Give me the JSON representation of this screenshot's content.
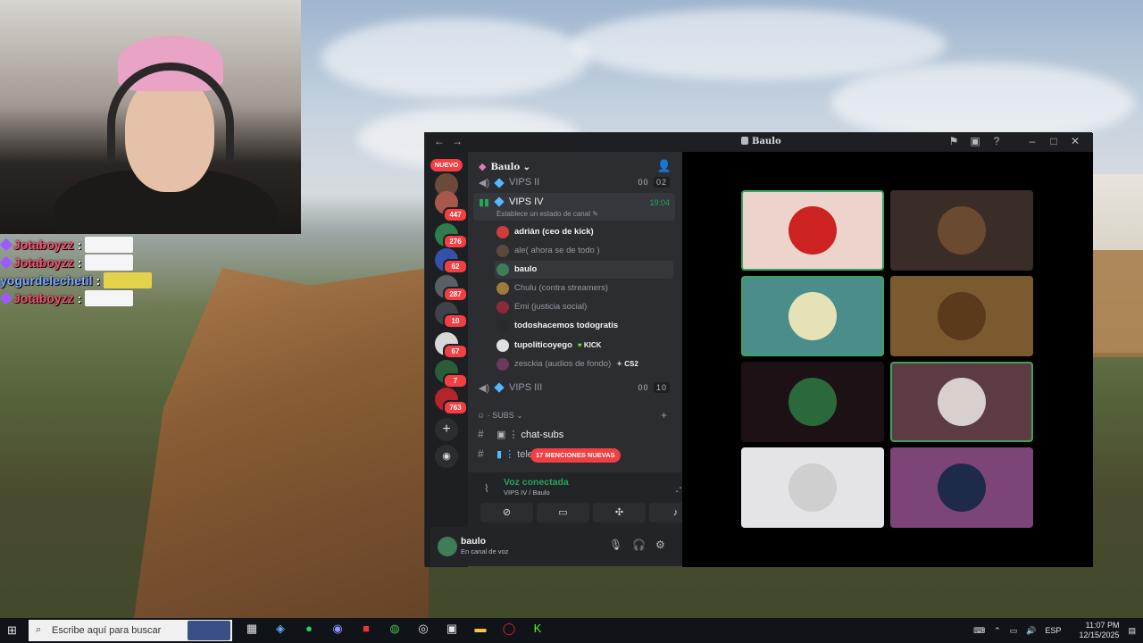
{
  "chat": [
    {
      "name": "Jotaboyzz",
      "color": "red"
    },
    {
      "name": "Jotaboyzz",
      "color": "red"
    },
    {
      "name": "yogurdelechetil",
      "color": "blue"
    },
    {
      "name": "Jotaboyzz",
      "color": "red"
    }
  ],
  "window": {
    "title": "Baulo",
    "back": "←",
    "forward": "→"
  },
  "servers": {
    "nuevo": "NUEVO",
    "badges": [
      "447",
      "276",
      "62",
      "287",
      "10",
      "67",
      "7",
      "763"
    ]
  },
  "server_header": {
    "name": "Baulo",
    "chevron": "⌄"
  },
  "channels": {
    "vips2": {
      "name": "VIPS II",
      "count": "00",
      "limit": "02"
    },
    "vips4": {
      "name": "VIPS IV",
      "time": "19:04",
      "status": "Establece un estado de canal"
    },
    "vips3": {
      "name": "VIPS III",
      "count": "00",
      "limit": "10"
    },
    "members": [
      {
        "name": "adrián (ceo de kick)",
        "bold": true
      },
      {
        "name": "ale( ahora se de todo )",
        "bold": false
      },
      {
        "name": "baulo",
        "bold": true
      },
      {
        "name": "Chulu (contra streamers)",
        "bold": false
      },
      {
        "name": "Emi (justicia social)",
        "bold": false
      },
      {
        "name": "todoshacemos todogratis",
        "bold": true
      },
      {
        "name": "tupoliticoyego",
        "bold": true,
        "tag": "KICK"
      },
      {
        "name": "zesckia (audios de fondo)",
        "bold": false,
        "tag": "CS2"
      }
    ],
    "category": "SUBS",
    "text_channels": [
      {
        "name": "chat-subs"
      },
      {
        "name": "tele"
      }
    ],
    "mentions_pill": "17 MENCIONES NUEVAS"
  },
  "voice": {
    "title": "Voz conectada",
    "subtitle": "VIPS IV / Baulo"
  },
  "user": {
    "name": "baulo",
    "status": "En canal de voz"
  },
  "taskbar": {
    "search_placeholder": "Escribe aquí para buscar",
    "lang": "ESP",
    "time": "11:07 PM",
    "date": "12/15/2025"
  }
}
